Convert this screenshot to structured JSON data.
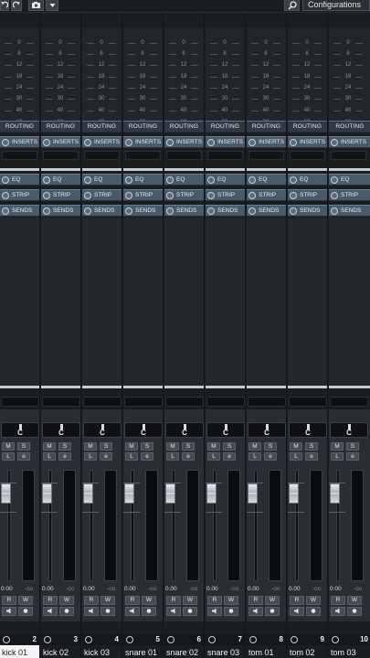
{
  "toolbar": {
    "undo_icon": "undo-icon",
    "redo_icon": "redo-icon",
    "camera_icon": "camera-icon",
    "dropdown_icon": "chevron-down-icon",
    "search_icon": "search-icon",
    "configurations_label": "Configurations"
  },
  "meter_scale": [
    "0",
    "6",
    "12",
    "18",
    "24",
    "30",
    "40",
    "60"
  ],
  "sections": {
    "routing": "ROUTING",
    "inserts": "INSERTS",
    "eq": "EQ",
    "strip": "STRIP",
    "sends": "SENDS"
  },
  "fader": {
    "pan_value": "C",
    "mute": "M",
    "solo": "S",
    "listen": "L",
    "edit": "e",
    "read": "R",
    "write": "W",
    "volume": "0.00",
    "peak": "-oo"
  },
  "channels": [
    {
      "name": "kick 01",
      "number": "2"
    },
    {
      "name": "kick 02",
      "number": "3"
    },
    {
      "name": "kick 03",
      "number": "4"
    },
    {
      "name": "snare 01",
      "number": "5"
    },
    {
      "name": "snare 02",
      "number": "6"
    },
    {
      "name": "snare 03",
      "number": "7"
    },
    {
      "name": "tom 01",
      "number": "8"
    },
    {
      "name": "tom 02",
      "number": "9"
    },
    {
      "name": "tom 03",
      "number": "10"
    }
  ],
  "selected_channel": "kick 01",
  "colors": {
    "accent_section": "#4a5a6a",
    "selected_name_bg": "#f4f5f6",
    "channel_color": "#7a2830"
  }
}
